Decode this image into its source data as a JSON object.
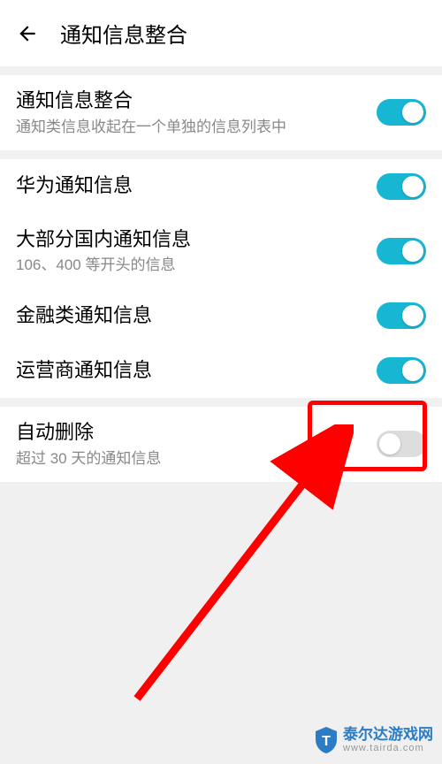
{
  "header": {
    "title": "通知信息整合"
  },
  "section1": {
    "row1": {
      "title": "通知信息整合",
      "subtitle": "通知类信息收起在一个单独的信息列表中",
      "toggle": true
    }
  },
  "section2": {
    "row1": {
      "title": "华为通知信息",
      "toggle": true
    },
    "row2": {
      "title": "大部分国内通知信息",
      "subtitle": "106、400 等开头的信息",
      "toggle": true
    },
    "row3": {
      "title": "金融类通知信息",
      "toggle": true
    },
    "row4": {
      "title": "运营商通知信息",
      "toggle": true
    }
  },
  "section3": {
    "row1": {
      "title": "自动删除",
      "subtitle": "超过 30 天的通知信息",
      "toggle": false
    }
  },
  "watermark": {
    "text": "泰尔达游戏网",
    "sub": "www.tairda.com"
  }
}
